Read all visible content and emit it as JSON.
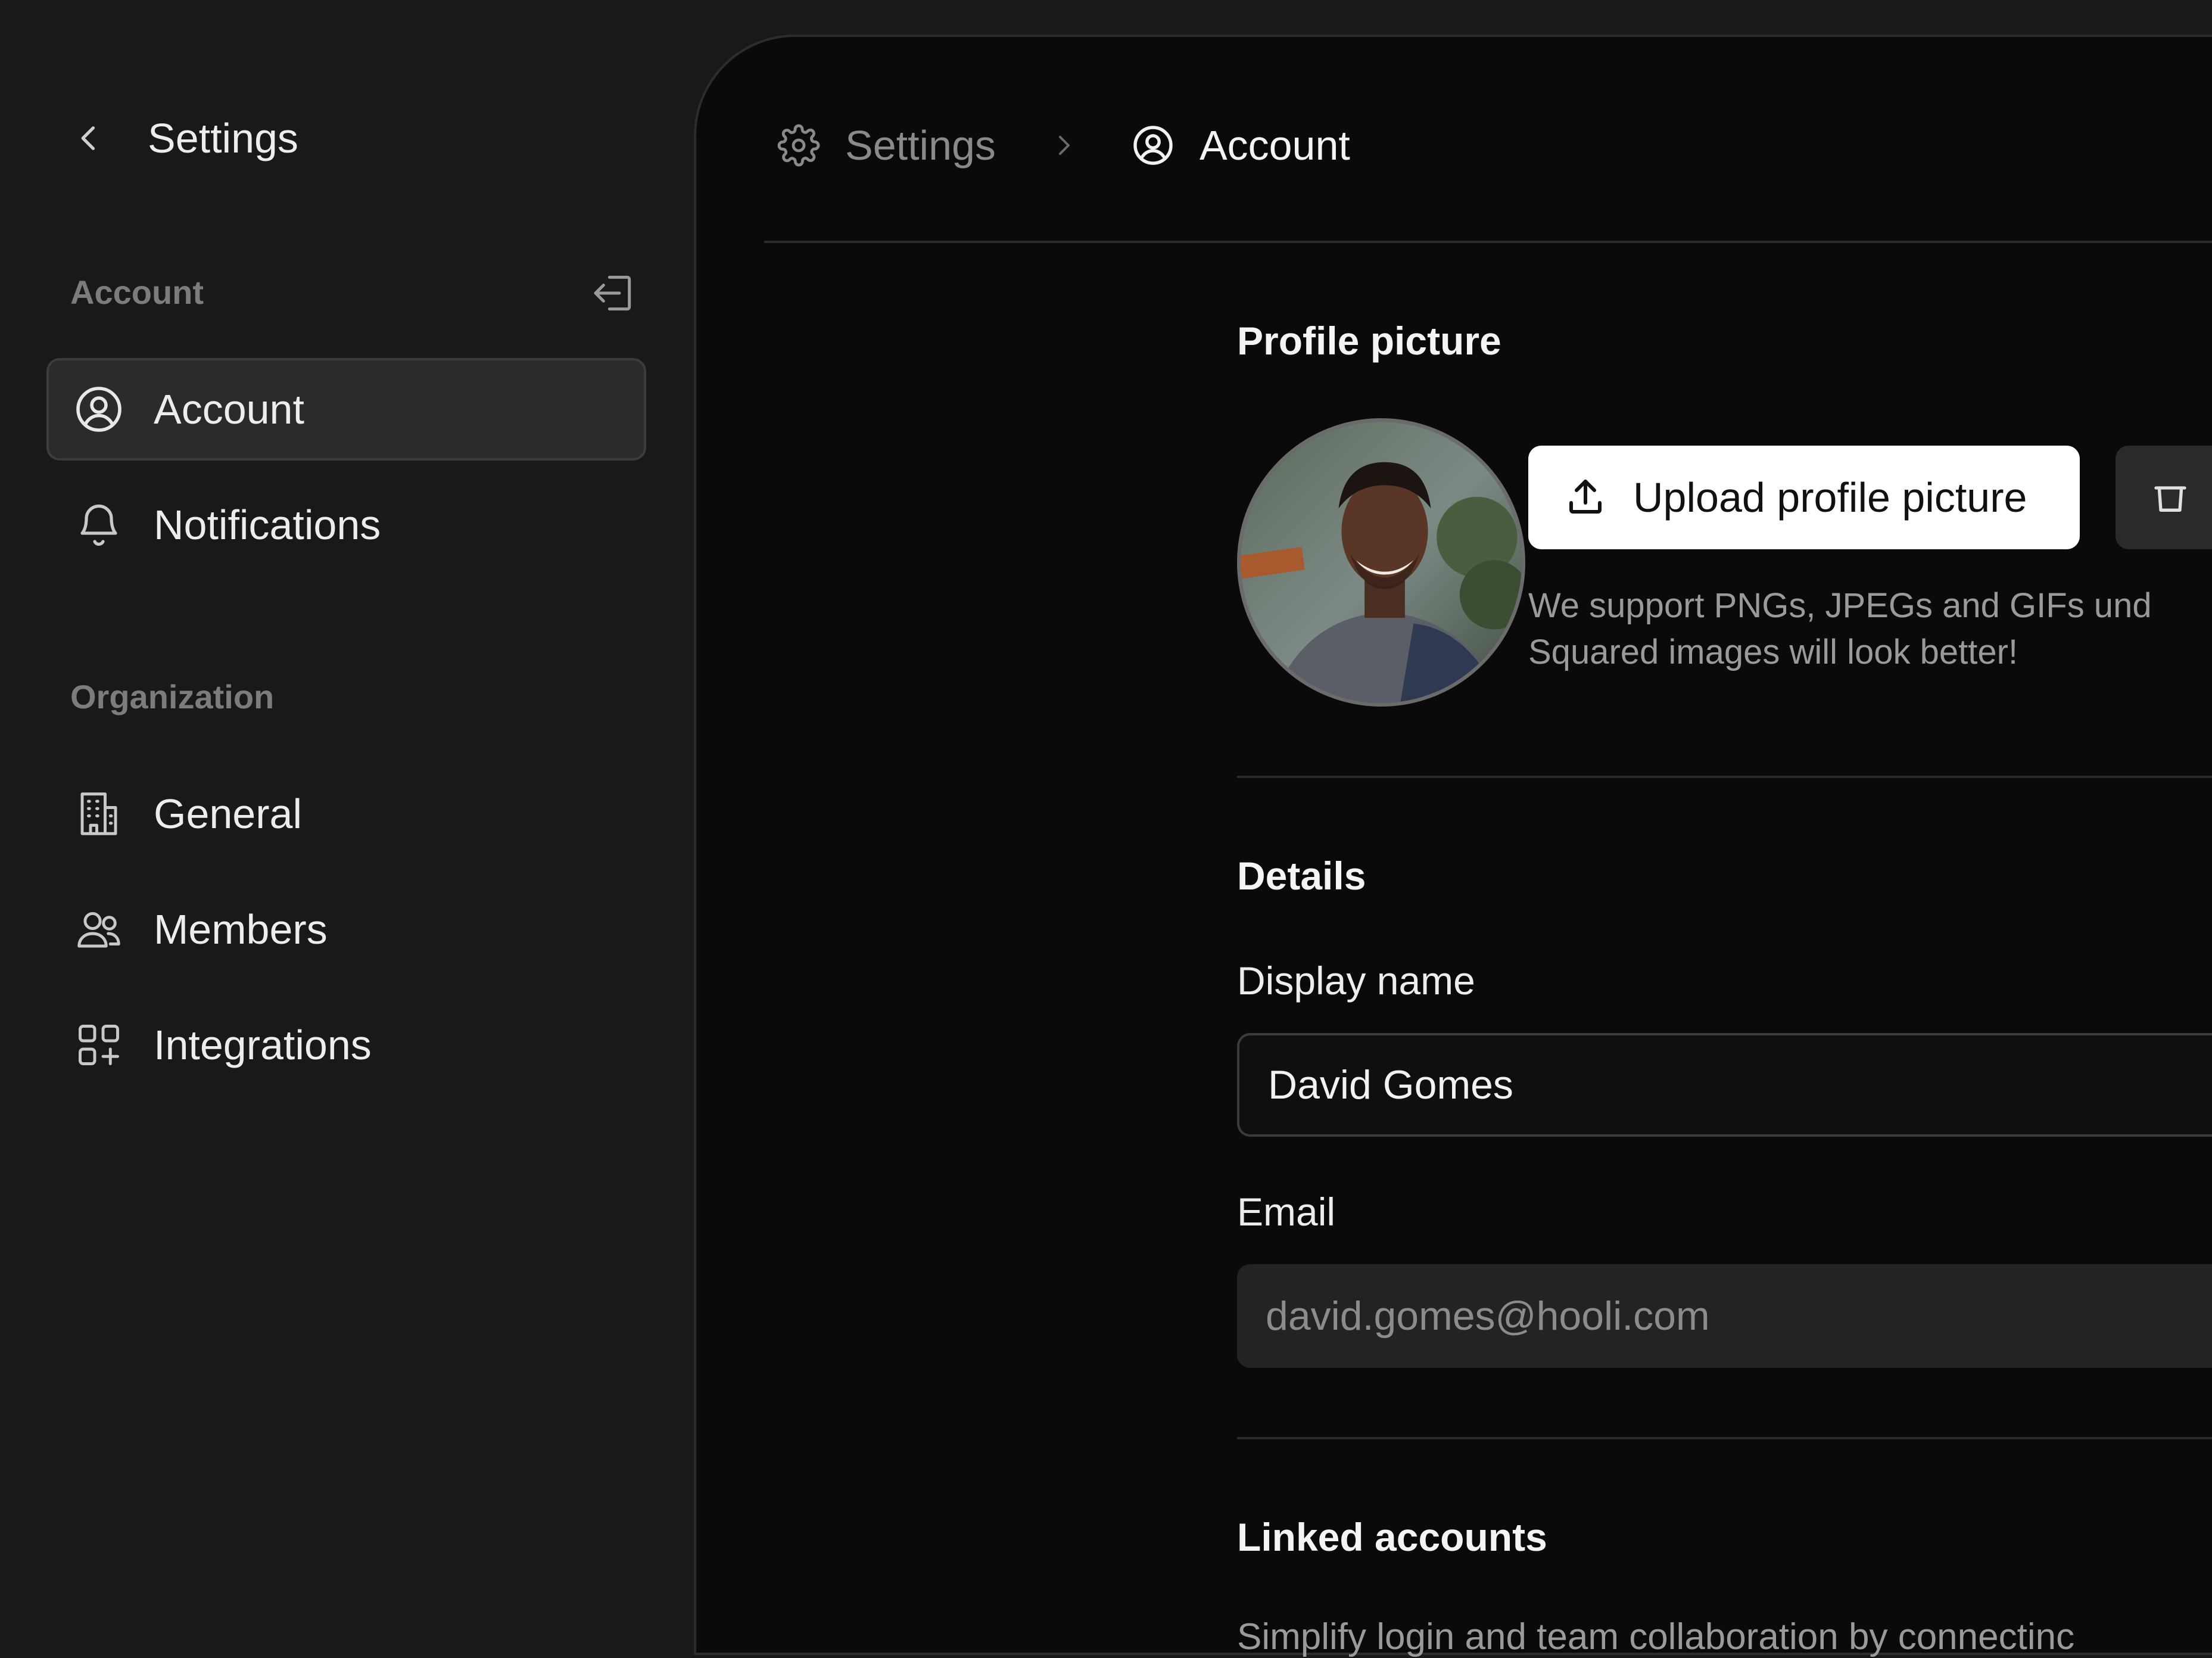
{
  "sidebar": {
    "back_label": "Settings",
    "sections": {
      "account_label": "Account",
      "organization_label": "Organization"
    },
    "items": [
      {
        "label": "Account",
        "icon": "user-circle-icon",
        "active": true
      },
      {
        "label": "Notifications",
        "icon": "bell-icon",
        "active": false
      },
      {
        "label": "General",
        "icon": "building-icon",
        "active": false
      },
      {
        "label": "Members",
        "icon": "users-icon",
        "active": false
      },
      {
        "label": "Integrations",
        "icon": "apps-add-icon",
        "active": false
      }
    ]
  },
  "breadcrumb": {
    "parent": "Settings",
    "current": "Account"
  },
  "profile": {
    "heading": "Profile picture",
    "upload_label": "Upload profile picture",
    "hint_line1": "We support PNGs, JPEGs and GIFs und",
    "hint_line2": "Squared images will look better!"
  },
  "details": {
    "heading": "Details",
    "display_name_label": "Display name",
    "display_name_value": "David Gomes",
    "email_label": "Email",
    "email_value": "david.gomes@hooli.com"
  },
  "linked": {
    "heading": "Linked accounts",
    "description": "Simplify login and team collaboration by connectinc"
  },
  "colors": {
    "sidebar_bg": "#191919",
    "main_bg": "#0a0a0b",
    "accent_button": "#ffffff"
  }
}
